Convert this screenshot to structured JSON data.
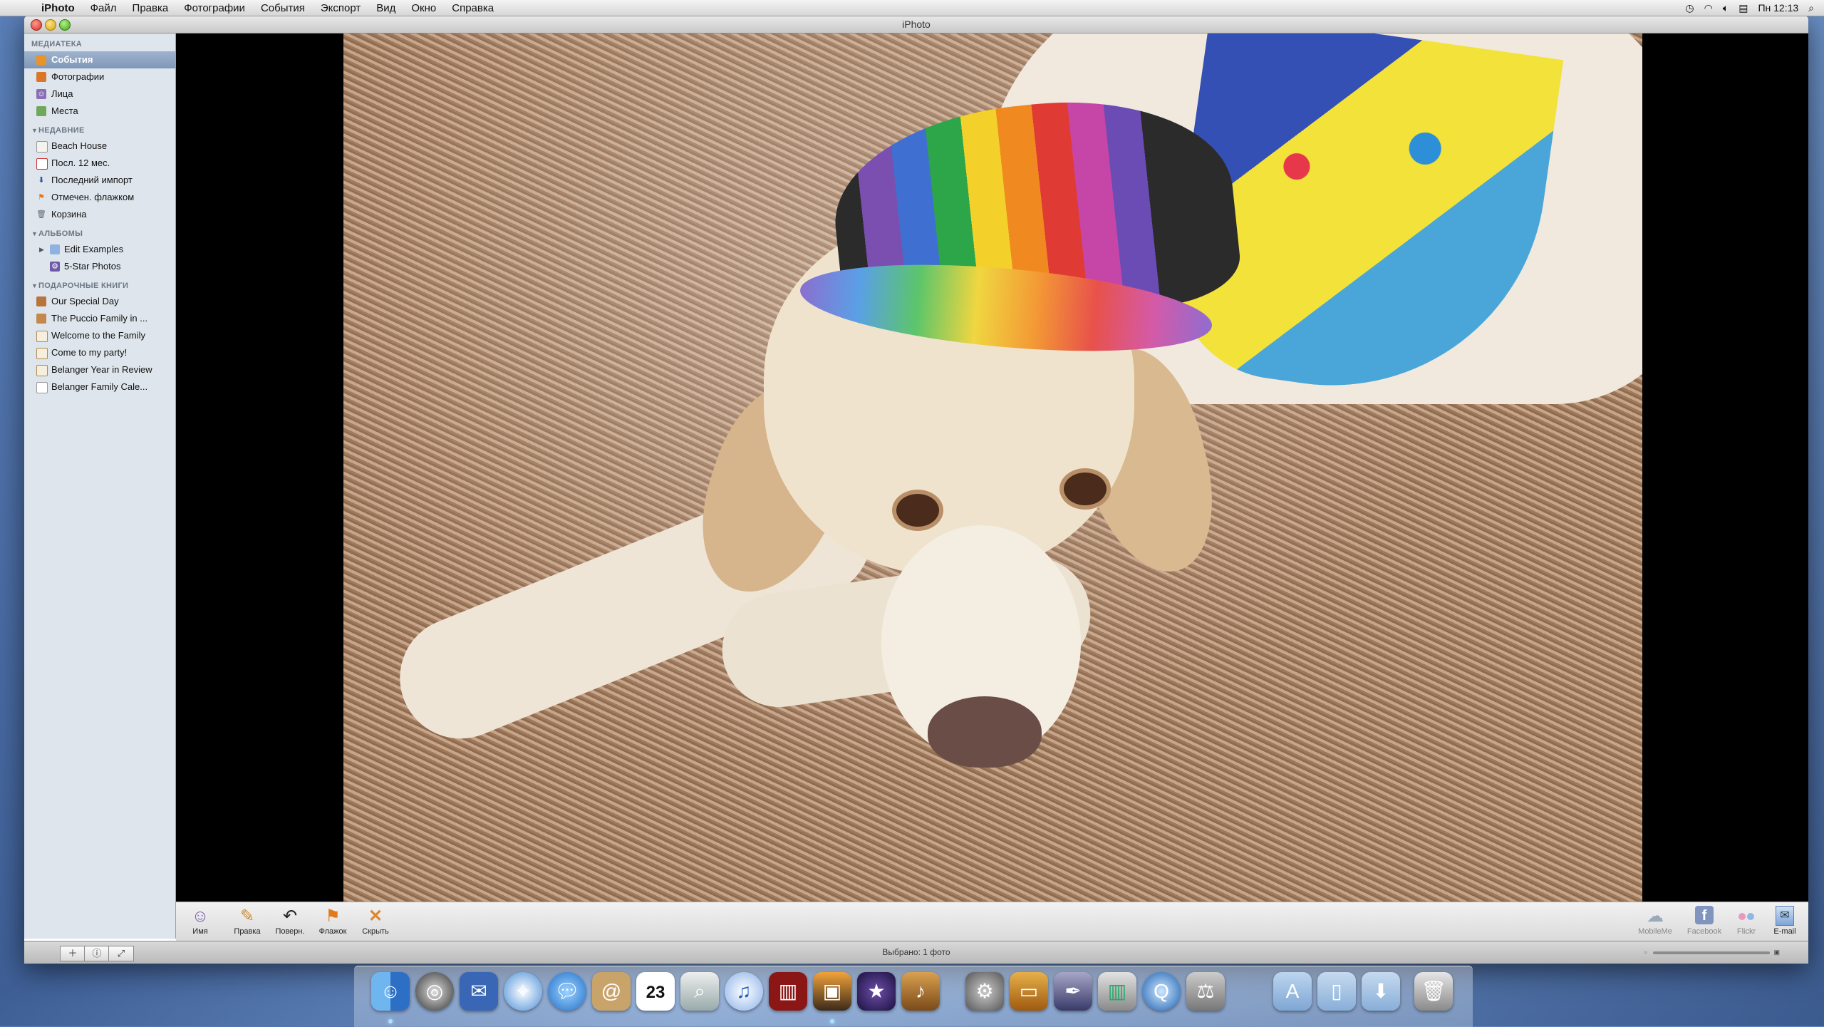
{
  "menubar": {
    "app": "iPhoto",
    "menus": [
      "Файл",
      "Правка",
      "Фотографии",
      "События",
      "Экспорт",
      "Вид",
      "Окно",
      "Справка"
    ],
    "clock": "Пн 12:13"
  },
  "window": {
    "title": "iPhoto"
  },
  "sidebar": {
    "sections": {
      "library": "МЕДИАТЕКА",
      "recent": "НЕДАВНИЕ",
      "albums": "АЛЬБОМЫ",
      "books": "ПОДАРОЧНЫЕ КНИГИ"
    },
    "library_items": [
      "События",
      "Фотографии",
      "Лица",
      "Места"
    ],
    "recent_items": [
      "Beach House",
      "Посл. 12 мес.",
      "Последний импорт",
      "Отмечен. флажком",
      "Корзина"
    ],
    "album_items": [
      "Edit Examples",
      "5-Star Photos"
    ],
    "book_items": [
      "Our Special Day",
      "The Puccio Family in ...",
      "Welcome to the Family",
      "Come to my party!",
      "Belanger Year in Review",
      "Belanger Family Cale..."
    ]
  },
  "toolbar": {
    "name": "Имя",
    "edit": "Правка",
    "rotate": "Поверн.",
    "flag": "Флажок",
    "hide": "Скрыть",
    "mobileme": "MobileMe",
    "facebook": "Facebook",
    "flickr": "Flickr",
    "email": "E-mail"
  },
  "statusbar": {
    "text": "Выбрано: 1 фото"
  },
  "dock": {
    "calendar_day": "23"
  },
  "colors": {
    "selection": "#7f97b8",
    "sidebar_bg": "#dfe5ec",
    "viewer_bg": "#000000"
  }
}
